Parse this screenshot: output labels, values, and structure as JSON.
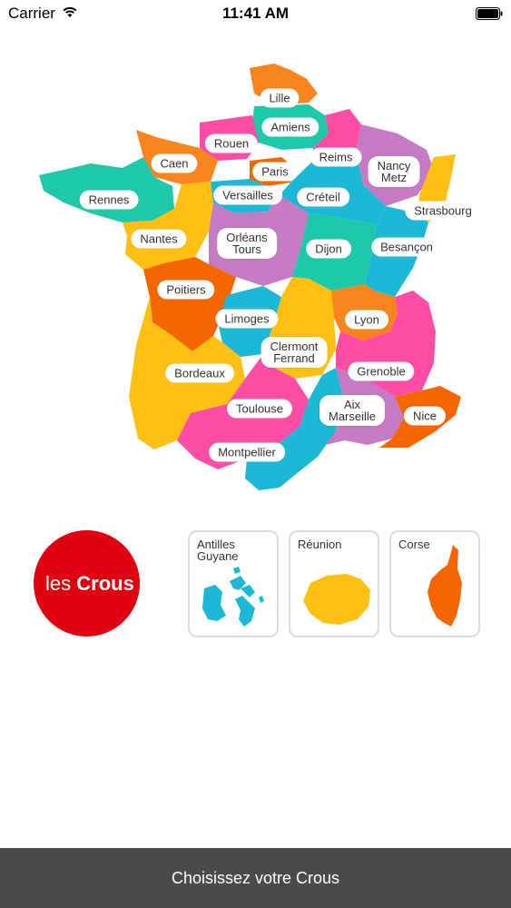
{
  "status_bar": {
    "carrier": "Carrier",
    "time": "11:41 AM",
    "wifi_icon": "wifi-icon",
    "battery_icon": "battery-icon"
  },
  "map": {
    "regions": [
      {
        "id": "lille",
        "label": "Lille",
        "color": "#f7841c"
      },
      {
        "id": "amiens",
        "label": "Amiens",
        "color": "#1dc9a8"
      },
      {
        "id": "rouen",
        "label": "Rouen",
        "color": "#ff4da6"
      },
      {
        "id": "caen",
        "label": "Caen",
        "color": "#f7841c"
      },
      {
        "id": "paris",
        "label": "Paris",
        "color": "#f56600"
      },
      {
        "id": "reims",
        "label": "Reims",
        "color": "#ff4da6"
      },
      {
        "id": "nancy_metz",
        "label": "Nancy\nMetz",
        "color": "#c47bc4"
      },
      {
        "id": "versailles",
        "label": "Versailles",
        "color": "#1cb9d6"
      },
      {
        "id": "creteil",
        "label": "Créteil",
        "color": "#1cb9d6"
      },
      {
        "id": "strasbourg",
        "label": "Strasbourg",
        "color": "#ffc012"
      },
      {
        "id": "rennes",
        "label": "Rennes",
        "color": "#1dc9a8"
      },
      {
        "id": "nantes",
        "label": "Nantes",
        "color": "#ffc012"
      },
      {
        "id": "orleans_tours",
        "label": "Orléans\nTours",
        "color": "#c47bc4"
      },
      {
        "id": "dijon",
        "label": "Dijon",
        "color": "#1dc9a8"
      },
      {
        "id": "besancon",
        "label": "Besançon",
        "color": "#1cb9d6"
      },
      {
        "id": "poitiers",
        "label": "Poitiers",
        "color": "#f56600"
      },
      {
        "id": "limoges",
        "label": "Limoges",
        "color": "#1cb9d6"
      },
      {
        "id": "lyon",
        "label": "Lyon",
        "color": "#f7841c"
      },
      {
        "id": "clermont_ferrand",
        "label": "Clermont\nFerrand",
        "color": "#ffc012"
      },
      {
        "id": "bordeaux",
        "label": "Bordeaux",
        "color": "#ffc012"
      },
      {
        "id": "grenoble",
        "label": "Grenoble",
        "color": "#ff4da6"
      },
      {
        "id": "toulouse",
        "label": "Toulouse",
        "color": "#ff4da6"
      },
      {
        "id": "aix_marseille",
        "label": "Aix\nMarseille",
        "color": "#c47bc4"
      },
      {
        "id": "nice",
        "label": "Nice",
        "color": "#f56600"
      },
      {
        "id": "montpellier",
        "label": "Montpellier",
        "color": "#1cb9d6"
      }
    ]
  },
  "logo": {
    "text_light": "les ",
    "text_bold": "Crous",
    "color": "#e1000f"
  },
  "overseas": [
    {
      "id": "antilles_guyane",
      "label": "Antilles\nGuyane",
      "color": "#1cb9d6"
    },
    {
      "id": "reunion",
      "label": "Réunion",
      "color": "#ffc012"
    },
    {
      "id": "corse",
      "label": "Corse",
      "color": "#f56600"
    }
  ],
  "footer": {
    "label": "Choisissez votre Crous",
    "background": "#4a4a4a"
  }
}
